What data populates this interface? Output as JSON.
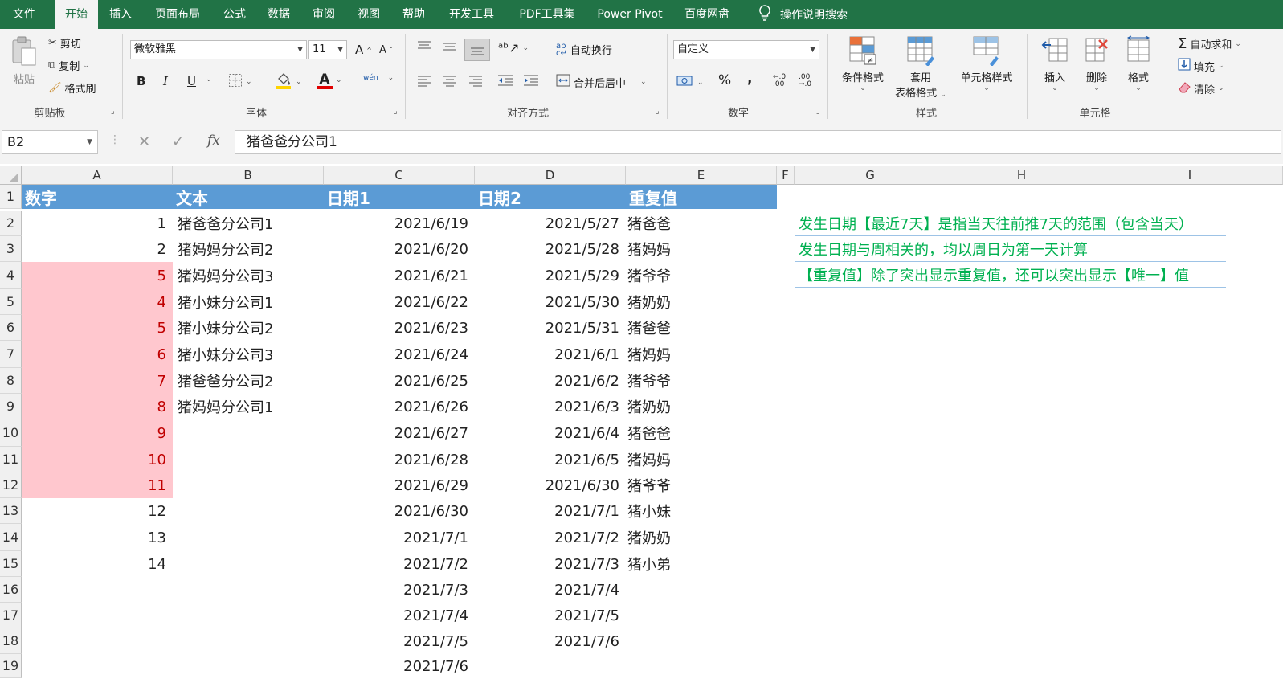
{
  "tabs": [
    "文件",
    "开始",
    "插入",
    "页面布局",
    "公式",
    "数据",
    "审阅",
    "视图",
    "帮助",
    "开发工具",
    "PDF工具集",
    "Power Pivot",
    "百度网盘"
  ],
  "search_label": "操作说明搜索",
  "ribbon": {
    "clipboard": {
      "paste": "粘贴",
      "cut": "剪切",
      "copy": "复制",
      "painter": "格式刷",
      "label": "剪贴板"
    },
    "font": {
      "name": "微软雅黑",
      "size": "11",
      "bold": "B",
      "italic": "I",
      "underline": "U",
      "font_color_glyph": "A",
      "wen": "wén",
      "label": "字体"
    },
    "align": {
      "wrap": "自动换行",
      "merge": "合并后居中",
      "label": "对齐方式"
    },
    "number": {
      "format": "自定义",
      "percent": "%",
      "comma": ",",
      "label": "数字"
    },
    "styles": {
      "cond": "条件格式",
      "table_l1": "套用",
      "table_l2": "表格格式",
      "cell": "单元格样式",
      "label": "样式"
    },
    "cells": {
      "insert": "插入",
      "delete": "删除",
      "format": "格式",
      "label": "单元格"
    },
    "editing": {
      "autosum": "自动求和",
      "fill": "填充",
      "clear": "清除"
    }
  },
  "formula_bar": {
    "name_box": "B2",
    "fx": "fx",
    "content": "猪爸爸分公司1"
  },
  "columns": [
    "A",
    "B",
    "C",
    "D",
    "E",
    "F",
    "G",
    "H",
    "I"
  ],
  "rows": [
    "1",
    "2",
    "3",
    "4",
    "5",
    "6",
    "7",
    "8",
    "9",
    "10",
    "11",
    "12",
    "13",
    "14",
    "15",
    "16",
    "17",
    "18",
    "19"
  ],
  "headers": {
    "A": "数字",
    "B": "文本",
    "C": "日期1",
    "D": "日期2",
    "E": "重复值"
  },
  "col_a": [
    "1",
    "2",
    "5",
    "4",
    "5",
    "6",
    "7",
    "8",
    "9",
    "10",
    "11",
    "12",
    "13",
    "14"
  ],
  "col_b": [
    "猪爸爸分公司1",
    "猪妈妈分公司2",
    "猪妈妈分公司3",
    "猪小妹分公司1",
    "猪小妹分公司2",
    "猪小妹分公司3",
    "猪爸爸分公司2",
    "猪妈妈分公司1"
  ],
  "col_c": [
    "2021/6/19",
    "2021/6/20",
    "2021/6/21",
    "2021/6/22",
    "2021/6/23",
    "2021/6/24",
    "2021/6/25",
    "2021/6/26",
    "2021/6/27",
    "2021/6/28",
    "2021/6/29",
    "2021/6/30",
    "2021/7/1",
    "2021/7/2",
    "2021/7/3",
    "2021/7/4",
    "2021/7/5",
    "2021/7/6"
  ],
  "col_d": [
    "2021/5/27",
    "2021/5/28",
    "2021/5/29",
    "2021/5/30",
    "2021/5/31",
    "2021/6/1",
    "2021/6/2",
    "2021/6/3",
    "2021/6/4",
    "2021/6/5",
    "2021/6/30",
    "2021/7/1",
    "2021/7/2",
    "2021/7/3",
    "2021/7/4",
    "2021/7/5",
    "2021/7/6"
  ],
  "col_e": [
    "猪爸爸",
    "猪妈妈",
    "猪爷爷",
    "猪奶奶",
    "猪爸爸",
    "猪妈妈",
    "猪爷爷",
    "猪奶奶",
    "猪爸爸",
    "猪妈妈",
    "猪爷爷",
    "猪小妹",
    "猪奶奶",
    "猪小弟"
  ],
  "notes": [
    "发生日期【最近7天】是指当天往前推7天的范围（包含当天）",
    "发生日期与周相关的，均以周日为第一天计算",
    "【重复值】除了突出显示重复值，还可以突出显示【唯一】值"
  ],
  "colors": {
    "excel_green": "#217346",
    "header_fill": "#5b9bd5",
    "highlight_fill": "#ffc7ce",
    "highlight_text": "#c00000",
    "note_text": "#00b050"
  }
}
